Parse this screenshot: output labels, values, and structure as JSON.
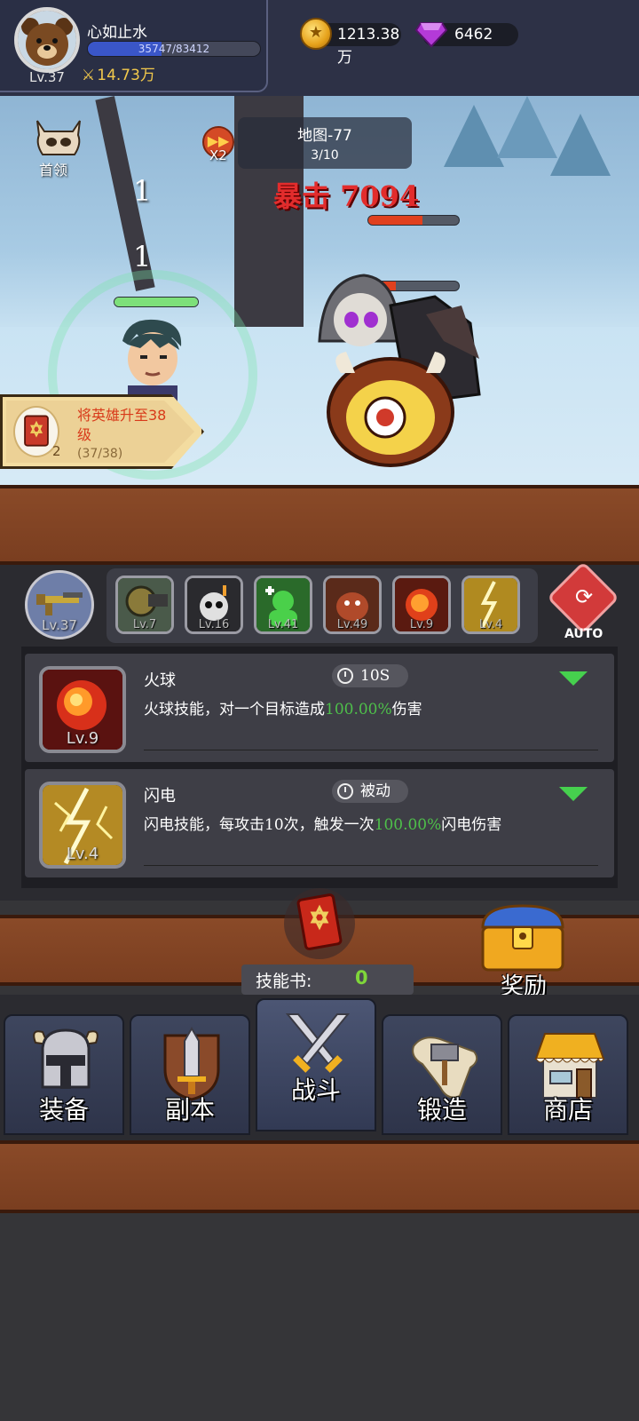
{
  "player": {
    "name": "心如止水",
    "level": "Lv.37",
    "xp_text": "35747/83412",
    "xp_fraction": 0.4286,
    "power": "14.73万"
  },
  "currency": {
    "gold": "1213.38万",
    "gems": "6462"
  },
  "battle": {
    "boss_label": "首领",
    "speed_label": "X2",
    "map_name": "地图-77",
    "wave": "3/10",
    "crit_text": "暴击 7094",
    "damage_numbers": [
      "1",
      "1"
    ],
    "enemy_hp_fraction": [
      0.6,
      0.3,
      0.0
    ],
    "hero_hp_fraction": 1.0
  },
  "quest": {
    "title": "将英雄升至38级",
    "count": "2",
    "progress": "(37/38)"
  },
  "skills_bar": {
    "weapon_level": "Lv.37",
    "slots": [
      {
        "icon": "cannon-icon",
        "level": "Lv.7"
      },
      {
        "icon": "bomb-icon",
        "level": "Lv.16"
      },
      {
        "icon": "heal-icon",
        "level": "Lv.41"
      },
      {
        "icon": "monster-icon",
        "level": "Lv.49"
      },
      {
        "icon": "fireball-icon",
        "level": "Lv.9"
      },
      {
        "icon": "lightning-icon",
        "level": "Lv.4"
      }
    ],
    "auto_label": "AUTO"
  },
  "skill_list": [
    {
      "name": "火球",
      "level": "Lv.9",
      "cooldown": "10S",
      "desc_pre": "火球技能，对一个目标造成",
      "desc_hl": "100.00%",
      "desc_post": "伤害",
      "icon": "fireball-icon"
    },
    {
      "name": "闪电",
      "level": "Lv.4",
      "cooldown": "被动",
      "desc_pre": "闪电技能，每攻击10次，触发一次",
      "desc_hl": "100.00%",
      "desc_post": "闪电伤害",
      "icon": "lightning-icon"
    }
  ],
  "skill_book": {
    "label": "技能书:",
    "value": "0"
  },
  "reward": {
    "label": "奖励"
  },
  "nav": [
    {
      "label": "装备",
      "icon": "helmet-icon",
      "active": false
    },
    {
      "label": "副本",
      "icon": "sword-shield-icon",
      "active": false
    },
    {
      "label": "战斗",
      "icon": "crossed-swords-icon",
      "active": true
    },
    {
      "label": "锻造",
      "icon": "hammer-scroll-icon",
      "active": false
    },
    {
      "label": "商店",
      "icon": "shop-icon",
      "active": false
    }
  ],
  "colors": {
    "crit": "#e22c2c",
    "highlight_green": "#4ec04a",
    "wood": "#7a3e20",
    "xp_fill": "#3a56c8"
  }
}
